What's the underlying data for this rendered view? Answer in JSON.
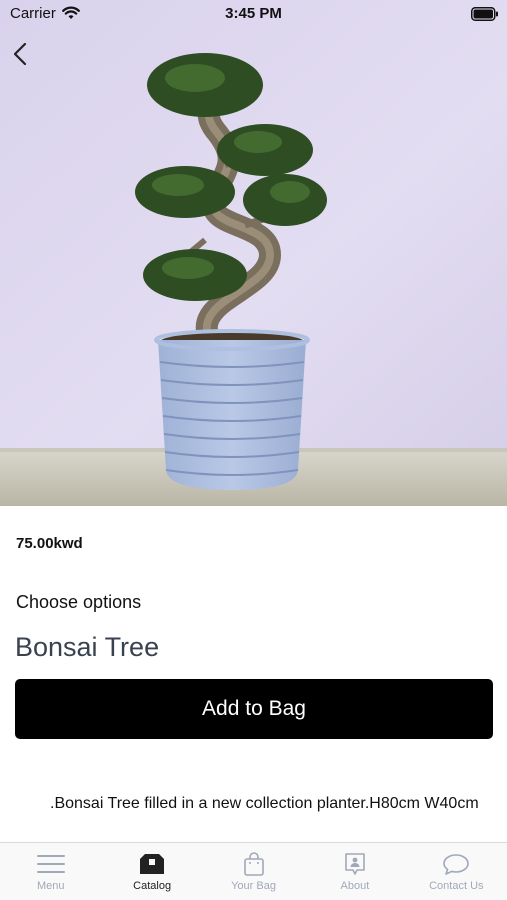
{
  "status_bar": {
    "carrier": "Carrier",
    "time": "3:45 PM"
  },
  "product": {
    "price": "75.00kwd",
    "choose_options_label": "Choose options",
    "name": "Bonsai Tree",
    "add_to_bag_label": "Add to Bag",
    "description": ".Bonsai Tree filled in a new collection planter.H80cm W40cm"
  },
  "tab_bar": {
    "tabs": [
      {
        "label": "Menu",
        "icon": "menu-icon",
        "active": false
      },
      {
        "label": "Catalog",
        "icon": "catalog-icon",
        "active": true
      },
      {
        "label": "Your Bag",
        "icon": "bag-icon",
        "active": false
      },
      {
        "label": "About",
        "icon": "about-icon",
        "active": false
      },
      {
        "label": "Contact Us",
        "icon": "chat-icon",
        "active": false
      }
    ]
  },
  "colors": {
    "accent_button": "#000000",
    "tab_inactive": "#a0a9b8",
    "tab_active": "#222222",
    "product_name": "#3a4250"
  }
}
